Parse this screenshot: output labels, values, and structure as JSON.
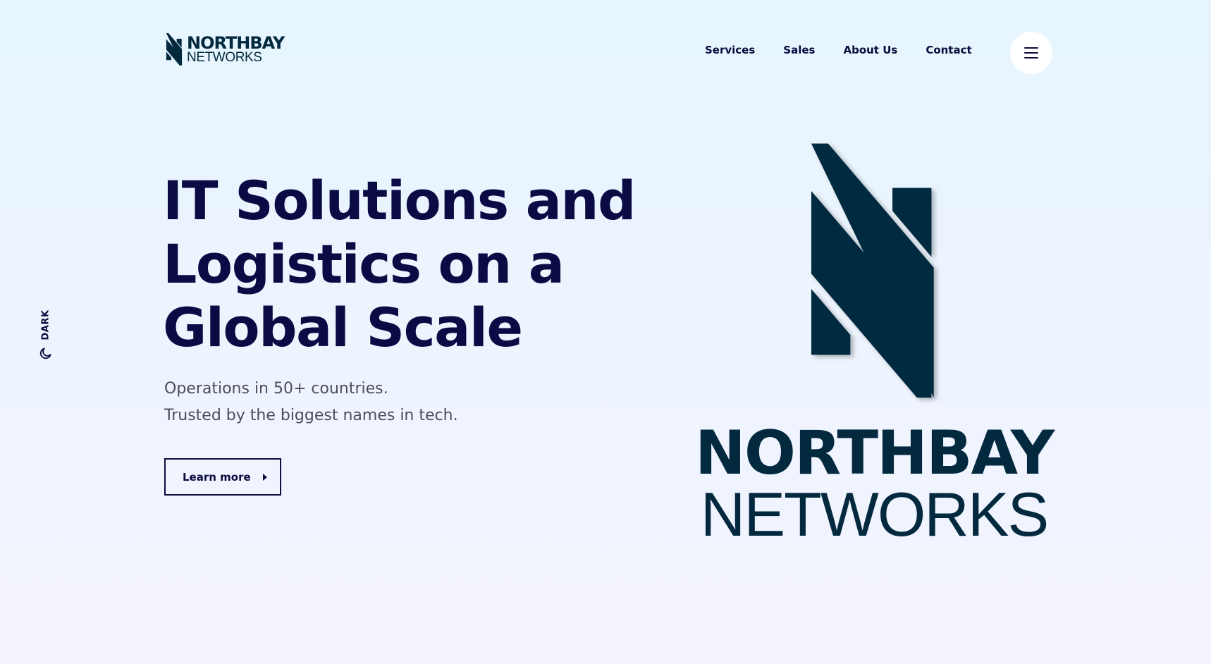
{
  "header": {
    "logo": {
      "icon": "northbay-n-logo-icon",
      "line1": "NORTHBAY",
      "line2": "NETWORKS"
    },
    "nav": [
      {
        "label": "Services"
      },
      {
        "label": "Sales"
      },
      {
        "label": "About Us"
      },
      {
        "label": "Contact"
      }
    ],
    "menu_icon": "hamburger-menu-icon"
  },
  "theme_toggle": {
    "label": "DARK",
    "icon": "moon-icon"
  },
  "hero": {
    "title_lines": [
      "IT Solutions and",
      "Logistics on a",
      "Global Scale"
    ],
    "subtitle_lines": [
      "Operations in 50+ countries.",
      "Trusted by the biggest names in tech."
    ],
    "cta_label": "Learn more",
    "cta_icon": "caret-right-icon"
  },
  "brand_logo": {
    "icon": "northbay-n-logo-icon",
    "line1": "NORTHBAY",
    "line2": "NETWORKS"
  },
  "colors": {
    "brand": "#03293f",
    "heading": "#0a0a45",
    "text_muted": "#4c4c5e",
    "background_top": "#e6f5fe",
    "background_bottom": "#f3f3fd"
  }
}
